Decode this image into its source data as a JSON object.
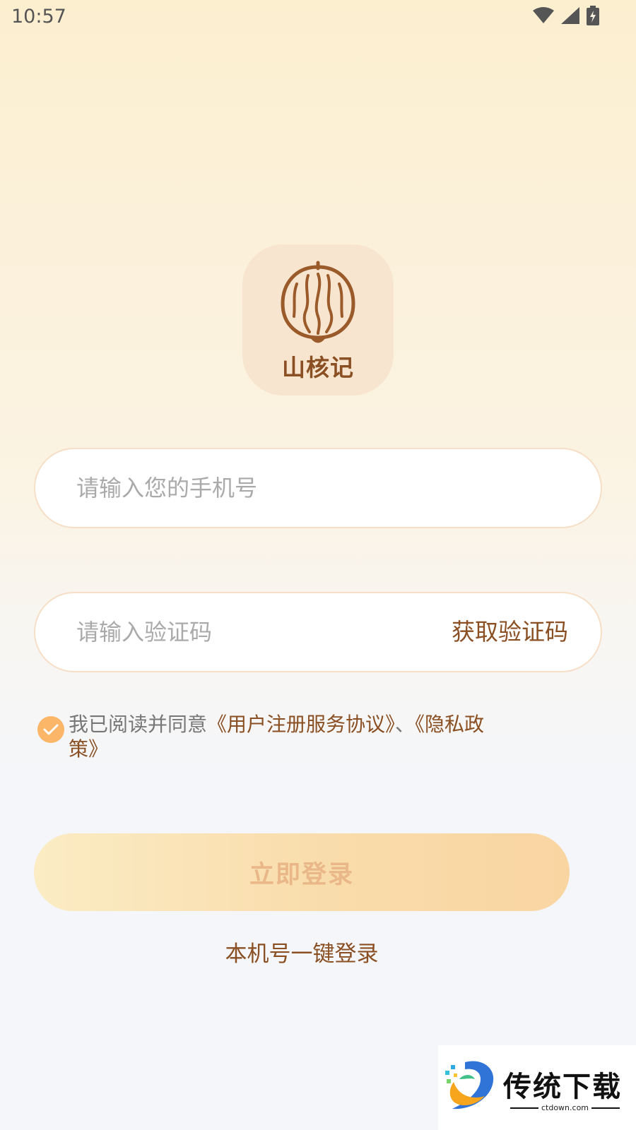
{
  "status_bar": {
    "time": "10:57"
  },
  "logo": {
    "text": "山核记",
    "icon": "walnut-icon"
  },
  "phone_input": {
    "placeholder": "请输入您的手机号",
    "value": ""
  },
  "code_input": {
    "placeholder": "请输入验证码",
    "value": "",
    "get_code_label": "获取验证码"
  },
  "agreement": {
    "checked": true,
    "prefix": "我已阅读并同意",
    "terms_link": "《用户注册服务协议》",
    "separator": "、",
    "privacy_link": "《隐私政策》"
  },
  "login_button": {
    "label": "立即登录"
  },
  "one_key_login": {
    "label": "本机号一键登录"
  },
  "watermark": {
    "title": "传统下载",
    "subtitle": "ctdown.com"
  },
  "colors": {
    "brand": "#8a4f22",
    "check": "#fbb767",
    "button_start": "#fbecc4",
    "button_end": "#f9d5a2"
  }
}
